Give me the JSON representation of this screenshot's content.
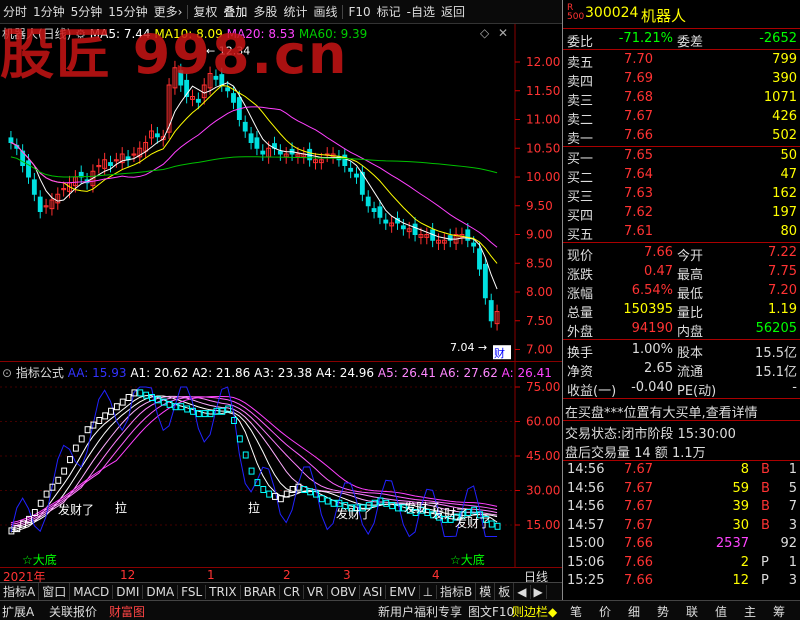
{
  "toolbar": {
    "items": [
      "分时",
      "1分钟",
      "5分钟",
      "15分钟",
      "更多›",
      "复权",
      "叠加",
      "多股",
      "统计",
      "画线",
      "F10",
      "标记",
      "-自选",
      "返回"
    ]
  },
  "main_chart": {
    "title": "机器人(日线)",
    "ma5": "MA5: 7.44",
    "ma10": "MA10: 8.09",
    "ma20": "MA20: 8.53",
    "ma60": "MA60: 9.39",
    "yticks": [
      "12.00",
      "11.50",
      "11.00",
      "10.50",
      "10.00",
      "9.50",
      "9.00",
      "8.50",
      "8.00",
      "7.50",
      "7.00"
    ],
    "high_label": "12.34",
    "low_label": "7.04",
    "cai_tag": "财",
    "watermark": "股匠 998.cn"
  },
  "indicator": {
    "name": "指标公式",
    "aa": "AA: 15.93",
    "a1": "A1: 20.62",
    "a2": "A2: 21.86",
    "a3": "A3: 23.38",
    "a4": "A4: 24.96",
    "a5": "A5: 26.41",
    "a6": "A6: 27.62",
    "a": "A: 26.41",
    "yticks": [
      "75.00",
      "60.00",
      "45.00",
      "30.00",
      "15.00"
    ],
    "fa1": "发财了",
    "la1": "拉",
    "la2": "拉",
    "fa2": "发财了",
    "fa3": "发财了",
    "fa4": "发财了",
    "fa5": "发财了",
    "low1": "☆大底",
    "low2": "☆大底"
  },
  "dates": {
    "year": "2021年",
    "m12": "12",
    "m1": "1",
    "m2": "2",
    "m3": "3",
    "m4": "4",
    "period": "日线"
  },
  "tabs": [
    "指标A",
    "窗口",
    "MACD",
    "DMI",
    "DMA",
    "FSL",
    "TRIX",
    "BRAR",
    "CR",
    "VR",
    "OBV",
    "ASI",
    "EMV",
    "⊥",
    "指标B",
    "模",
    "板",
    "◀",
    "▶"
  ],
  "bottom": {
    "left": [
      "扩展A",
      "关联报价",
      "财富图"
    ],
    "mid": [
      "新用户福利专享",
      "图文F10",
      "则边栏◆"
    ],
    "right": [
      "笔",
      "价",
      "细",
      "势",
      "联",
      "值",
      "主",
      "筹"
    ]
  },
  "quote": {
    "code": "300024",
    "name": "机器人",
    "badge": "R",
    "badge_sub": "500",
    "wb_label": "委比",
    "wb": "-71.21%",
    "wc_label": "委差",
    "wc": "-2652",
    "sells": [
      {
        "l": "卖五",
        "p": "7.70",
        "v": "799"
      },
      {
        "l": "卖四",
        "p": "7.69",
        "v": "390"
      },
      {
        "l": "卖三",
        "p": "7.68",
        "v": "1071"
      },
      {
        "l": "卖二",
        "p": "7.67",
        "v": "426"
      },
      {
        "l": "卖一",
        "p": "7.66",
        "v": "502"
      }
    ],
    "buys": [
      {
        "l": "买一",
        "p": "7.65",
        "v": "50"
      },
      {
        "l": "买二",
        "p": "7.64",
        "v": "47"
      },
      {
        "l": "买三",
        "p": "7.63",
        "v": "162"
      },
      {
        "l": "买四",
        "p": "7.62",
        "v": "197"
      },
      {
        "l": "买五",
        "p": "7.61",
        "v": "80"
      }
    ],
    "stats": [
      [
        "现价",
        "7.66",
        "今开",
        "7.22"
      ],
      [
        "涨跌",
        "0.47",
        "最高",
        "7.75"
      ],
      [
        "涨幅",
        "6.54%",
        "最低",
        "7.20"
      ],
      [
        "总量",
        "150395",
        "量比",
        "1.19"
      ],
      [
        "外盘",
        "94190",
        "内盘",
        "56205"
      ]
    ],
    "stats2": [
      [
        "换手",
        "1.00%",
        "股本",
        "15.5亿"
      ],
      [
        "净资",
        "2.65",
        "流通",
        "15.1亿"
      ],
      [
        "收益(一)",
        "-0.040",
        "PE(动)",
        "-"
      ]
    ],
    "notice": "在买盘***位置有大买单,查看详情",
    "status": "交易状态:闭市阶段 15:30:00",
    "after": "盘后交易量 14 额 1.1万",
    "ticks": [
      [
        "14:56",
        "7.67",
        "8",
        "B",
        "1"
      ],
      [
        "14:56",
        "7.67",
        "59",
        "B",
        "5"
      ],
      [
        "14:56",
        "7.67",
        "39",
        "B",
        "7"
      ],
      [
        "14:57",
        "7.67",
        "30",
        "B",
        "3"
      ],
      [
        "15:00",
        "7.66",
        "2537",
        "",
        "92"
      ],
      [
        "15:06",
        "7.66",
        "2",
        "P",
        "1"
      ],
      [
        "15:25",
        "7.66",
        "12",
        "P",
        "3"
      ]
    ]
  },
  "colors": {
    "up": "#ff3030",
    "down": "#00e0e0",
    "yellow": "#ffff00",
    "green": "#00ff00",
    "ma5": "#ffffff",
    "ma10": "#ffff00",
    "ma20": "#ff40ff",
    "ma60": "#00c000"
  }
}
